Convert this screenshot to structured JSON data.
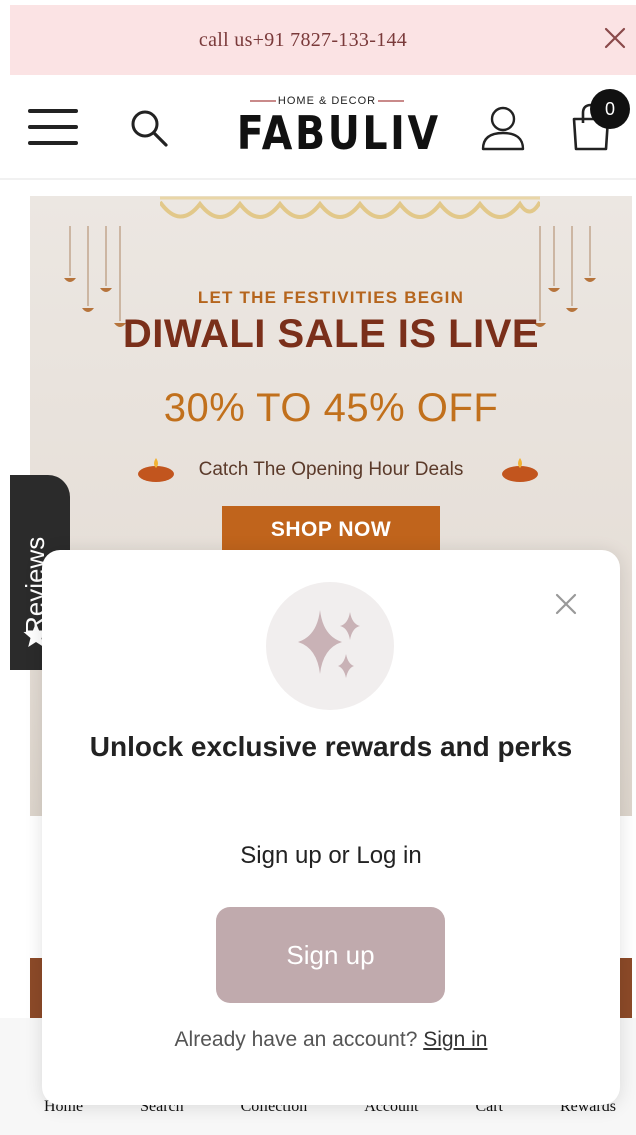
{
  "announcement": {
    "text": "call us+91 7827-133-144",
    "close_icon": "close-icon"
  },
  "header": {
    "menu_icon": "hamburger-icon",
    "search_icon": "search-icon",
    "logo": {
      "tagline": "HOME & DECOR",
      "name": "FABULIV"
    },
    "account_icon": "user-icon",
    "cart_icon": "shopping-bag-icon",
    "cart_count": "0"
  },
  "hero": {
    "eyebrow": "LET THE FESTIVITIES BEGIN",
    "title": "DIWALI SALE IS LIVE",
    "offer": "30% TO 45% OFF",
    "subline": "Catch The Opening Hour Deals",
    "cta": "SHOP NOW",
    "colors": {
      "eyebrow": "#b5651d",
      "title": "#7a2f1a",
      "offer": "#c1701c",
      "cta_bg": "#c0641c"
    }
  },
  "reviews_tab": {
    "label": "Reviews",
    "icon": "star-icon"
  },
  "popup": {
    "icon": "sparkles-icon",
    "heading": "Unlock exclusive rewards and perks",
    "subheading": "Sign up or Log in",
    "signup_button": "Sign up",
    "account_prompt": "Already have an account?",
    "signin_link": "Sign in",
    "close_icon": "close-icon",
    "colors": {
      "signup_bg": "#c0aaad"
    }
  },
  "bottom_nav": {
    "items": [
      "Home",
      "Search",
      "Collection",
      "Account",
      "Cart",
      "Rewards"
    ]
  }
}
